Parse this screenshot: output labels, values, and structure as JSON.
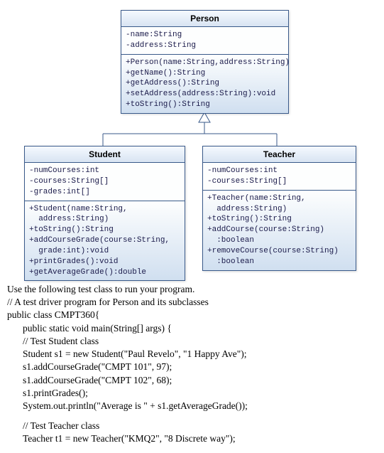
{
  "uml": {
    "person": {
      "title": "Person",
      "attrs": [
        "-name:String",
        "-address:String"
      ],
      "methods": [
        "+Person(name:String,address:String)",
        "+getName():String",
        "+getAddress():String",
        "+setAddress(address:String):void",
        "+toString():String"
      ]
    },
    "student": {
      "title": "Student",
      "attrs": [
        "-numCourses:int",
        "-courses:String[]",
        "-grades:int[]"
      ],
      "methods": [
        "+Student(name:String,",
        "  address:String)",
        "+toString():String",
        "+addCourseGrade(course:String,",
        "  grade:int):void",
        "+printGrades():void",
        "+getAverageGrade():double"
      ]
    },
    "teacher": {
      "title": "Teacher",
      "attrs": [
        "-numCourses:int",
        "-courses:String[]"
      ],
      "methods": [
        "+Teacher(name:String,",
        "  address:String)",
        "+toString():String",
        "+addCourse(course:String)",
        "  :boolean",
        "+removeCourse(course:String)",
        "  :boolean"
      ]
    }
  },
  "prose": {
    "p1": "Use the following test class to run your program.",
    "p2": "// A test driver program for Person and its subclasses",
    "p3": "public class CMPT360{",
    "p4": "public static void main(String[] args) {",
    "p5": "// Test Student class",
    "p6": "Student s1 = new Student(\"Paul Revelo\", \"1 Happy Ave\");",
    "p7": "s1.addCourseGrade(\"CMPT 101\", 97);",
    "p8": "s1.addCourseGrade(\"CMPT 102\", 68);",
    "p9": "s1.printGrades();",
    "p10": "System.out.println(\"Average is \" + s1.getAverageGrade());",
    "p11": "// Test Teacher class",
    "p12": "Teacher t1 = new Teacher(\"KMQ2\", \"8 Discrete way\");"
  }
}
